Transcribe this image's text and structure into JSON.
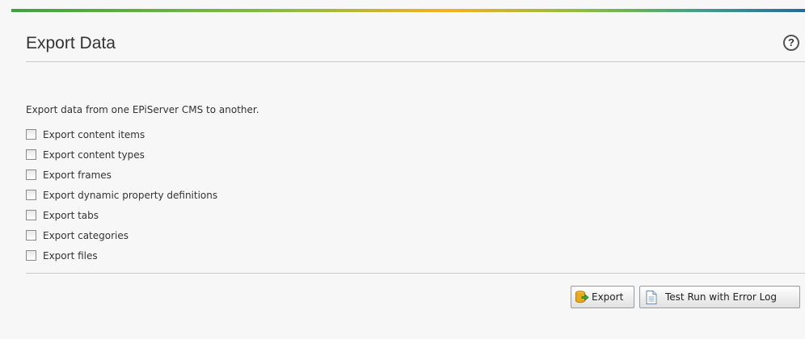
{
  "header": {
    "title": "Export Data",
    "help_icon": "question-mark-icon"
  },
  "description": "Export data from one EPiServer CMS to another.",
  "options": [
    {
      "label": "Export content items",
      "checked": false
    },
    {
      "label": "Export content types",
      "checked": false
    },
    {
      "label": "Export frames",
      "checked": false
    },
    {
      "label": "Export dynamic property definitions",
      "checked": false
    },
    {
      "label": "Export tabs",
      "checked": false
    },
    {
      "label": "Export categories",
      "checked": false
    },
    {
      "label": "Export files",
      "checked": false
    }
  ],
  "actions": {
    "export_label": "Export",
    "export_icon": "database-export-icon",
    "test_run_label": "Test Run with Error Log",
    "test_run_icon": "document-icon"
  },
  "colors": {
    "accent_bar": [
      "#41a044",
      "#f4b120",
      "#1c6f98"
    ],
    "background": "#f7f7f7"
  }
}
